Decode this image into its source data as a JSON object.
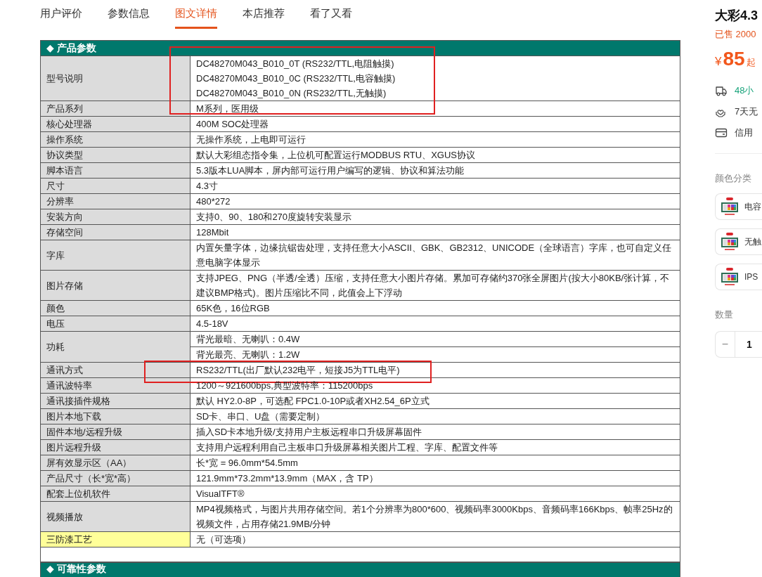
{
  "tabs": [
    {
      "label": "用户评价",
      "selected": false
    },
    {
      "label": "参数信息",
      "selected": false
    },
    {
      "label": "图文详情",
      "selected": true
    },
    {
      "label": "本店推荐",
      "selected": false
    },
    {
      "label": "看了又看",
      "selected": false
    }
  ],
  "spec_sections": [
    {
      "marker": "◆",
      "title": "产品参数",
      "rows": [
        {
          "label": "型号说明",
          "kind": "lines",
          "highlighted": false,
          "annotated": true,
          "values": [
            "DC48270M043_B010_0T (RS232/TTL,电阻触摸)",
            "DC48270M043_B010_0C (RS232/TTL,电容触摸)",
            "DC48270M043_B010_0N (RS232/TTL,无触摸)"
          ]
        },
        {
          "label": "产品系列",
          "kind": "lines",
          "highlighted": false,
          "annotated": false,
          "values": [
            "M系列，医用级"
          ]
        },
        {
          "label": "核心处理器",
          "kind": "lines",
          "highlighted": false,
          "annotated": false,
          "values": [
            "400M SOC处理器"
          ]
        },
        {
          "label": "操作系统",
          "kind": "lines",
          "highlighted": false,
          "annotated": false,
          "values": [
            "无操作系统，上电即可运行"
          ]
        },
        {
          "label": "协议类型",
          "kind": "lines",
          "highlighted": false,
          "annotated": false,
          "values": [
            "默认大彩组态指令集，上位机可配置运行MODBUS RTU、XGUS协议"
          ]
        },
        {
          "label": "脚本语言",
          "kind": "lines",
          "highlighted": false,
          "annotated": false,
          "values": [
            "5.3版本LUA脚本，屏内部可运行用户编写的逻辑、协议和算法功能"
          ]
        },
        {
          "label": "尺寸",
          "kind": "lines",
          "highlighted": false,
          "annotated": false,
          "values": [
            "4.3寸"
          ]
        },
        {
          "label": "分辨率",
          "kind": "lines",
          "highlighted": false,
          "annotated": false,
          "values": [
            "480*272"
          ]
        },
        {
          "label": "安装方向",
          "kind": "lines",
          "highlighted": false,
          "annotated": false,
          "values": [
            "支持0、90、180和270度旋转安装显示"
          ]
        },
        {
          "label": "存储空间",
          "kind": "lines",
          "highlighted": false,
          "annotated": false,
          "values": [
            "128Mbit"
          ]
        },
        {
          "label": "字库",
          "kind": "lines",
          "highlighted": false,
          "annotated": false,
          "values": [
            "内置矢量字体，边缘抗锯齿处理，支持任意大小ASCII、GBK、GB2312、UNICODE（全球语言）字库，也可自定义任意电脑字体显示"
          ]
        },
        {
          "label": "图片存储",
          "kind": "lines",
          "highlighted": false,
          "annotated": false,
          "values": [
            "支持JPEG、PNG（半透/全透）压缩，支持任意大小图片存储。累加可存储约370张全屏图片(按大小80KB/张计算，不建议BMP格式)。图片压缩比不同，此值会上下浮动"
          ]
        },
        {
          "label": "颜色",
          "kind": "lines",
          "highlighted": false,
          "annotated": false,
          "values": [
            "65K色，16位RGB"
          ]
        },
        {
          "label": "电压",
          "kind": "lines",
          "highlighted": false,
          "annotated": false,
          "values": [
            "4.5-18V"
          ]
        },
        {
          "label": "功耗",
          "kind": "split",
          "highlighted": false,
          "annotated": false,
          "values": [
            "背光最暗、无喇叭：0.4W",
            "背光最亮、无喇叭：1.2W"
          ]
        },
        {
          "label": "通讯方式",
          "kind": "lines",
          "highlighted": false,
          "annotated": true,
          "values": [
            "RS232/TTL(出厂默认232电平，短接J5为TTL电平)"
          ]
        },
        {
          "label": "通讯波特率",
          "kind": "lines",
          "highlighted": false,
          "annotated": false,
          "values": [
            "1200～921600bps,典型波特率：115200bps"
          ]
        },
        {
          "label": "通讯接插件规格",
          "kind": "lines",
          "highlighted": false,
          "annotated": false,
          "values": [
            "默认 HY2.0-8P，可选配 FPC1.0-10P或者XH2.54_6P立式"
          ]
        },
        {
          "label": "图片本地下载",
          "kind": "lines",
          "highlighted": false,
          "annotated": false,
          "values": [
            "SD卡、串口、U盘（需要定制）"
          ]
        },
        {
          "label": "固件本地/远程升级",
          "kind": "lines",
          "highlighted": false,
          "annotated": false,
          "values": [
            "插入SD卡本地升级/支持用户主板远程串口升级屏幕固件"
          ]
        },
        {
          "label": "图片远程升级",
          "kind": "lines",
          "highlighted": false,
          "annotated": false,
          "values": [
            "支持用户远程利用自己主板串口升级屏幕相关图片工程、字库、配置文件等"
          ]
        },
        {
          "label": "屏有效显示区（AA）",
          "kind": "lines",
          "highlighted": false,
          "annotated": false,
          "values": [
            "长*宽 = 96.0mm*54.5mm"
          ]
        },
        {
          "label": "产品尺寸（长*宽*高）",
          "kind": "lines",
          "highlighted": false,
          "annotated": false,
          "values": [
            "121.9mm*73.2mm*13.9mm（MAX，含 TP）"
          ]
        },
        {
          "label": "配套上位机软件",
          "kind": "lines",
          "highlighted": false,
          "annotated": false,
          "values": [
            "VisualTFT®"
          ]
        },
        {
          "label": "视频播放",
          "kind": "lines",
          "highlighted": false,
          "annotated": false,
          "values": [
            "MP4视频格式，与图片共用存储空间。若1个分辨率为800*600、视频码率3000Kbps、音频码率166Kbps、帧率25Hz的视频文件，占用存储21.9MB/分钟"
          ]
        },
        {
          "label": "三防漆工艺",
          "kind": "lines",
          "highlighted": true,
          "annotated": false,
          "values": [
            "无（可选项）"
          ]
        }
      ]
    },
    {
      "marker": "◆",
      "title": "可靠性参数"
    }
  ],
  "product": {
    "title": "大彩4.3",
    "sold": "已售 2000",
    "currency": "¥",
    "price": "85",
    "price_suffix": "起",
    "services": [
      {
        "kind": "truck",
        "text": "48小",
        "color": "#17a37a"
      },
      {
        "kind": "care",
        "text": "7天无",
        "color": "#333333"
      },
      {
        "kind": "card",
        "text": "信用",
        "color": "#333333"
      }
    ],
    "options_label": "颜色分类",
    "options": [
      {
        "label": "电容",
        "kind": "picture"
      },
      {
        "label": "无触",
        "kind": "picture"
      },
      {
        "label": "IPS",
        "kind": "picture"
      }
    ],
    "quantity_label": "数量",
    "minus": "−",
    "quantity": "1"
  }
}
